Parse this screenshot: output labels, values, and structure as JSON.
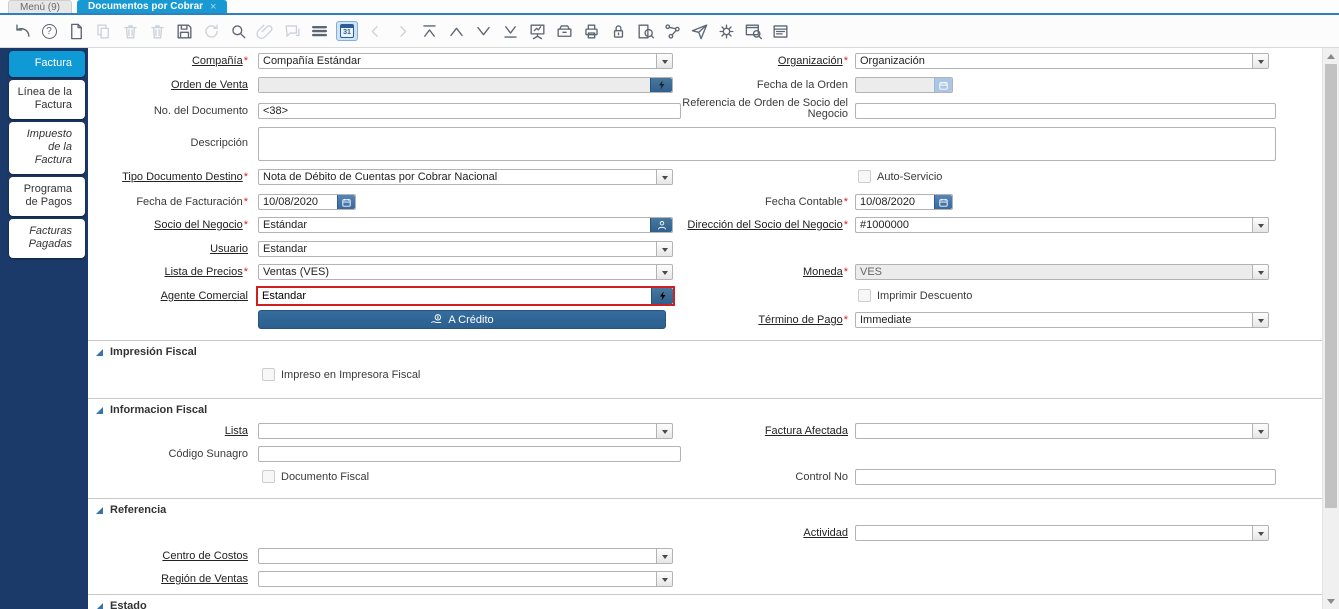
{
  "colors": {
    "accent_blue": "#1899d2",
    "sidebar_navy": "#1b3a69",
    "button_blue": "#2d6496",
    "highlight_red": "#cf1f1f"
  },
  "icons": {
    "close": "×",
    "help": "?",
    "calendar_day": "31"
  },
  "window_tabs": {
    "menu": "Menú (9)",
    "active": "Documentos por Cobrar"
  },
  "toolbar": {
    "icon_names": [
      "undo",
      "help",
      "new-record",
      "copy-record",
      "delete-record",
      "delete-selection",
      "save",
      "refresh",
      "find",
      "attachment",
      "chat",
      "grid-toggle",
      "calendar",
      "parent-record",
      "detail-record",
      "first-record",
      "previous-record",
      "next-record",
      "last-record",
      "report",
      "archive",
      "print",
      "lock",
      "zoom-across",
      "workflow",
      "send-mail",
      "process",
      "record-info",
      "report-window"
    ]
  },
  "sidebar": {
    "tabs": [
      {
        "label": "Factura"
      },
      {
        "label": "Línea de la Factura"
      },
      {
        "label": "Impuesto de la Factura"
      },
      {
        "label": "Programa de Pagos"
      },
      {
        "label": "Facturas Pagadas"
      }
    ]
  },
  "form": {
    "required_marker": "*",
    "sections": {
      "impresion": "Impresión Fiscal",
      "informacion": "Informacion Fiscal",
      "referencia": "Referencia",
      "estado": "Estado"
    },
    "buttons": {
      "a_credito": "A Crédito"
    },
    "fields": {
      "compania": {
        "label": "Compañía",
        "value": "Compañía Estándar"
      },
      "organizacion": {
        "label": "Organización",
        "value": "Organización"
      },
      "orden_venta": {
        "label": "Orden de Venta",
        "value": ""
      },
      "fecha_orden": {
        "label": "Fecha de la Orden",
        "value": ""
      },
      "no_documento": {
        "label": "No. del Documento",
        "value": "<38>"
      },
      "referencia_orden": {
        "label": "Referencia de Orden de Socio del Negocio",
        "value": ""
      },
      "descripcion": {
        "label": "Descripción",
        "value": ""
      },
      "tipo_documento": {
        "label": "Tipo Documento Destino",
        "value": "Nota de Débito de Cuentas por Cobrar Nacional"
      },
      "auto_servicio": {
        "label": "Auto-Servicio"
      },
      "fecha_facturacion": {
        "label": "Fecha de Facturación",
        "value": "10/08/2020"
      },
      "fecha_contable": {
        "label": "Fecha Contable",
        "value": "10/08/2020"
      },
      "socio_negocio": {
        "label": "Socio del Negocio",
        "value": "Estándar"
      },
      "direccion_socio": {
        "label": "Dirección del Socio del Negocio",
        "value": "#1000000"
      },
      "usuario": {
        "label": "Usuario",
        "value": "Estandar"
      },
      "lista_precios": {
        "label": "Lista de Precios",
        "value": "Ventas (VES)"
      },
      "moneda": {
        "label": "Moneda",
        "value": "VES"
      },
      "agente_comercial": {
        "label": "Agente Comercial",
        "value": "Estandar"
      },
      "imprimir_descuento": {
        "label": "Imprimir Descuento"
      },
      "termino_pago": {
        "label": "Término de Pago",
        "value": "Immediate"
      },
      "impreso_impresora": {
        "label": "Impreso en Impresora Fiscal"
      },
      "lista": {
        "label": "Lista",
        "value": ""
      },
      "factura_afectada": {
        "label": "Factura Afectada",
        "value": ""
      },
      "codigo_sunagro": {
        "label": "Código Sunagro",
        "value": ""
      },
      "documento_fiscal": {
        "label": "Documento Fiscal"
      },
      "control_no": {
        "label": "Control No",
        "value": ""
      },
      "actividad": {
        "label": "Actividad",
        "value": ""
      },
      "centro_costos": {
        "label": "Centro de Costos",
        "value": ""
      },
      "region_ventas": {
        "label": "Región de Ventas",
        "value": ""
      }
    }
  }
}
